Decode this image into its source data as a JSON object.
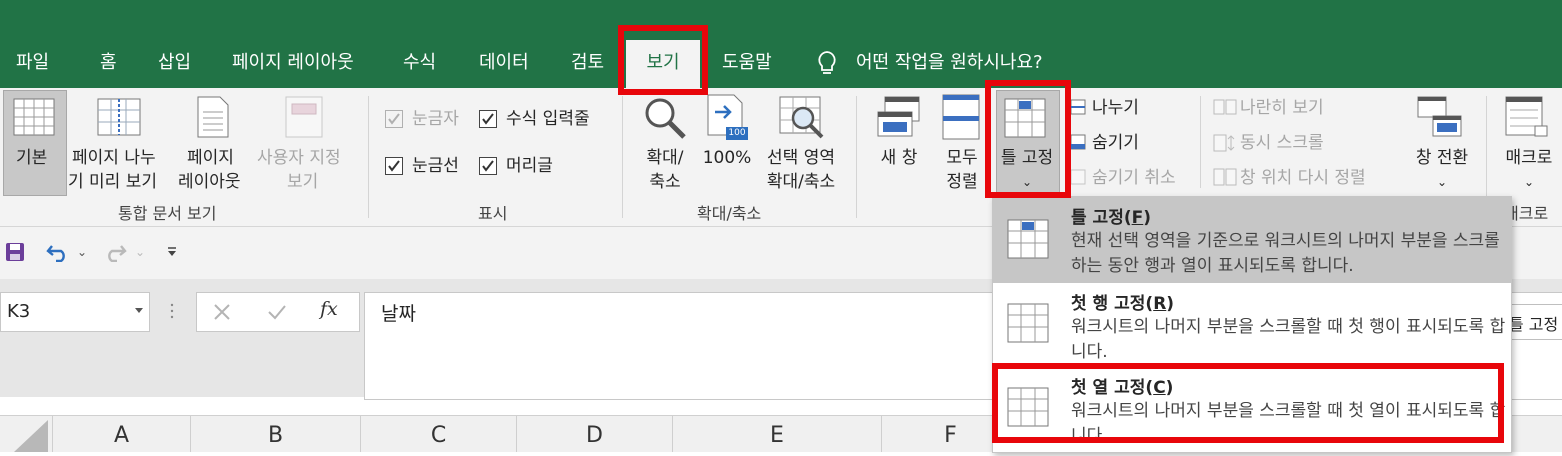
{
  "tabs": [
    "파일",
    "홈",
    "삽입",
    "페이지 레이아웃",
    "수식",
    "데이터",
    "검토",
    "보기",
    "도움말"
  ],
  "tell_me": "어떤 작업을 원하시나요?",
  "ribbon": {
    "workbook_views": {
      "normal": "기본",
      "page_break_1": "페이지 나누",
      "page_break_2": "기 미리 보기",
      "page_layout_1": "페이지",
      "page_layout_2": "레이아웃",
      "custom_1": "사용자 지정",
      "custom_2": "보기",
      "label": "통합 문서 보기"
    },
    "show": {
      "ruler": "눈금자",
      "formula_bar": "수식 입력줄",
      "gridlines": "눈금선",
      "headings": "머리글",
      "label": "표시"
    },
    "zoom": {
      "zoom_1": "확대/",
      "zoom_2": "축소",
      "zoom_100": "100%",
      "zoom_100_badge": "100",
      "zoom_sel_1": "선택 영역",
      "zoom_sel_2": "확대/축소",
      "label": "확대/축소"
    },
    "window": {
      "new_window": "새 창",
      "arrange_1": "모두",
      "arrange_2": "정렬",
      "freeze": "틀 고정",
      "split": "나누기",
      "hide": "숨기기",
      "unhide": "숨기기 취소",
      "side_by_side": "나란히 보기",
      "sync_scroll": "동시 스크롤",
      "reset_position": "창 위치 다시 정렬",
      "switch": "창 전환",
      "chevron": "⌄"
    },
    "macros": {
      "label_btn": "매크로",
      "label": "매크로"
    }
  },
  "qat": {
    "more": "⌄"
  },
  "formula_bar": {
    "name_box": "K3",
    "fx": "fx",
    "content": "날짜"
  },
  "columns": [
    "A",
    "B",
    "C",
    "D",
    "E",
    "F"
  ],
  "freeze_menu": [
    {
      "title": "틀 고정",
      "key": "F",
      "desc": "현재 선택 영역을 기준으로 워크시트의 나머지 부분을 스크롤하는 동안 행과 열이 표시되도록 합니다."
    },
    {
      "title": "첫 행 고정",
      "key": "R",
      "desc": "워크시트의 나머지 부분을 스크롤할 때 첫 행이 표시되도록 합니다."
    },
    {
      "title": "첫 열 고정",
      "key": "C",
      "desc": "워크시트의 나머지 부분을 스크롤할 때 첫 열이 표시되도록 합니다."
    }
  ],
  "tooltip": "틀 고정",
  "colors": {
    "excel_green": "#217346",
    "highlight_red": "#e8060b",
    "ribbon_bg": "#f3f3f3"
  }
}
